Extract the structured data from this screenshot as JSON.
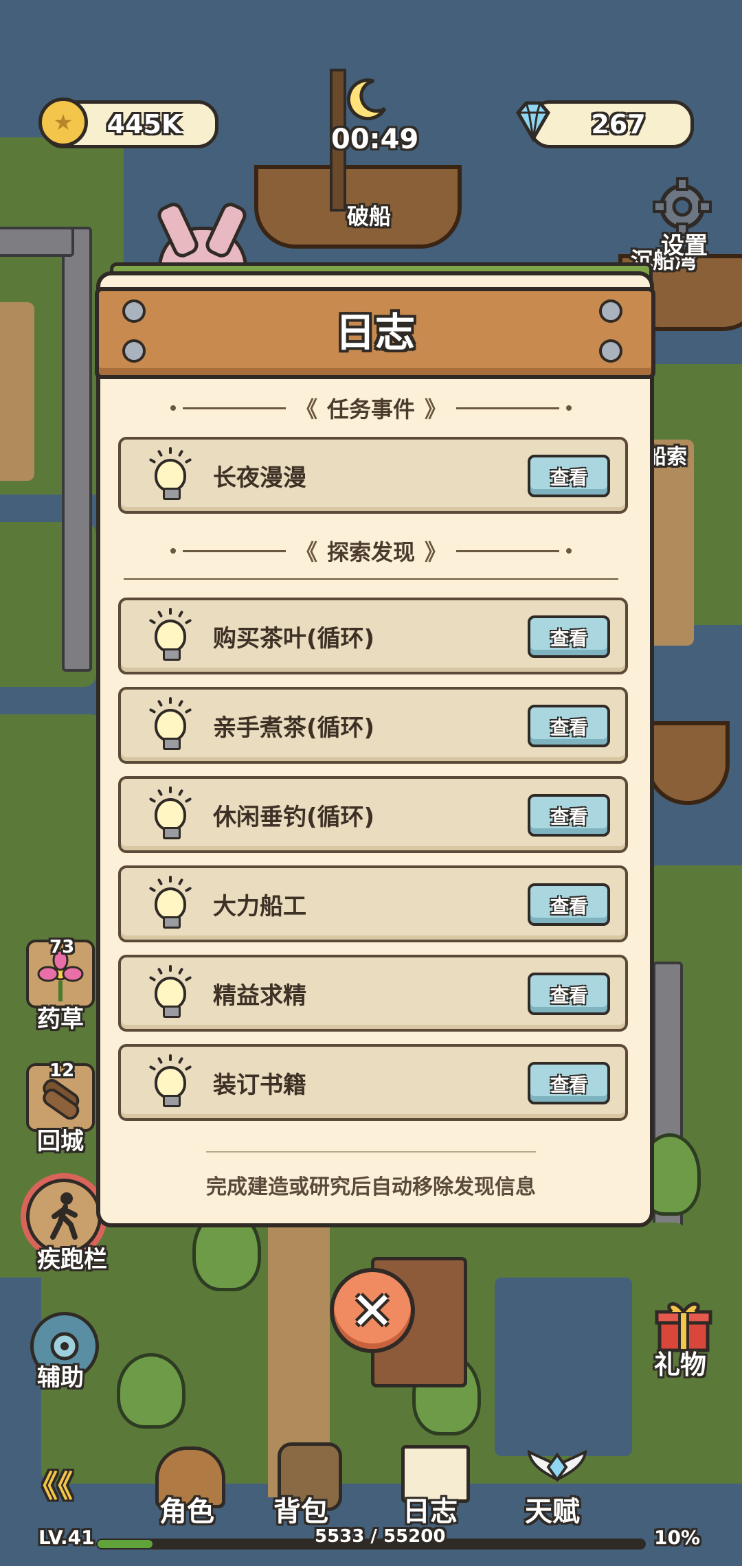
{
  "hud": {
    "coins": "445K",
    "gems": "267",
    "timer": "00:49",
    "settings_label": "设置"
  },
  "map_labels": {
    "broken_boat": "破船",
    "sunken_bay": "沉船湾",
    "mooring_rope": "船索"
  },
  "journal": {
    "title": "日志",
    "quests_header": "任务事件",
    "quests": [
      {
        "label": "长夜漫漫",
        "button": "查看"
      }
    ],
    "discover_header": "探索发现",
    "discoveries": [
      {
        "label": "购买茶叶(循环)",
        "button": "查看"
      },
      {
        "label": "亲手煮茶(循环)",
        "button": "查看"
      },
      {
        "label": "休闲垂钓(循环)",
        "button": "查看"
      },
      {
        "label": "大力船工",
        "button": "查看"
      },
      {
        "label": "精益求精",
        "button": "查看"
      },
      {
        "label": "装订书籍",
        "button": "查看"
      }
    ],
    "footer": "完成建造或研究后自动移除发现信息"
  },
  "side": {
    "herb_count": "73",
    "herb_label": "药草",
    "return_count": "12",
    "return_label": "回城",
    "sprint_label": "疾跑栏",
    "assist_label": "辅助",
    "gift_label": "礼物"
  },
  "bottom": {
    "tabs": [
      "角色",
      "背包",
      "日志",
      "天赋"
    ],
    "level": "LV.41",
    "xp": "5533 / 55200",
    "xp_fraction": 0.1,
    "percent": "10%"
  },
  "colors": {
    "panel_bg": "#fcf1d8",
    "header_wood": "#c88a4f",
    "view_button": "#a9d6df",
    "close_button": "#f08a60"
  }
}
